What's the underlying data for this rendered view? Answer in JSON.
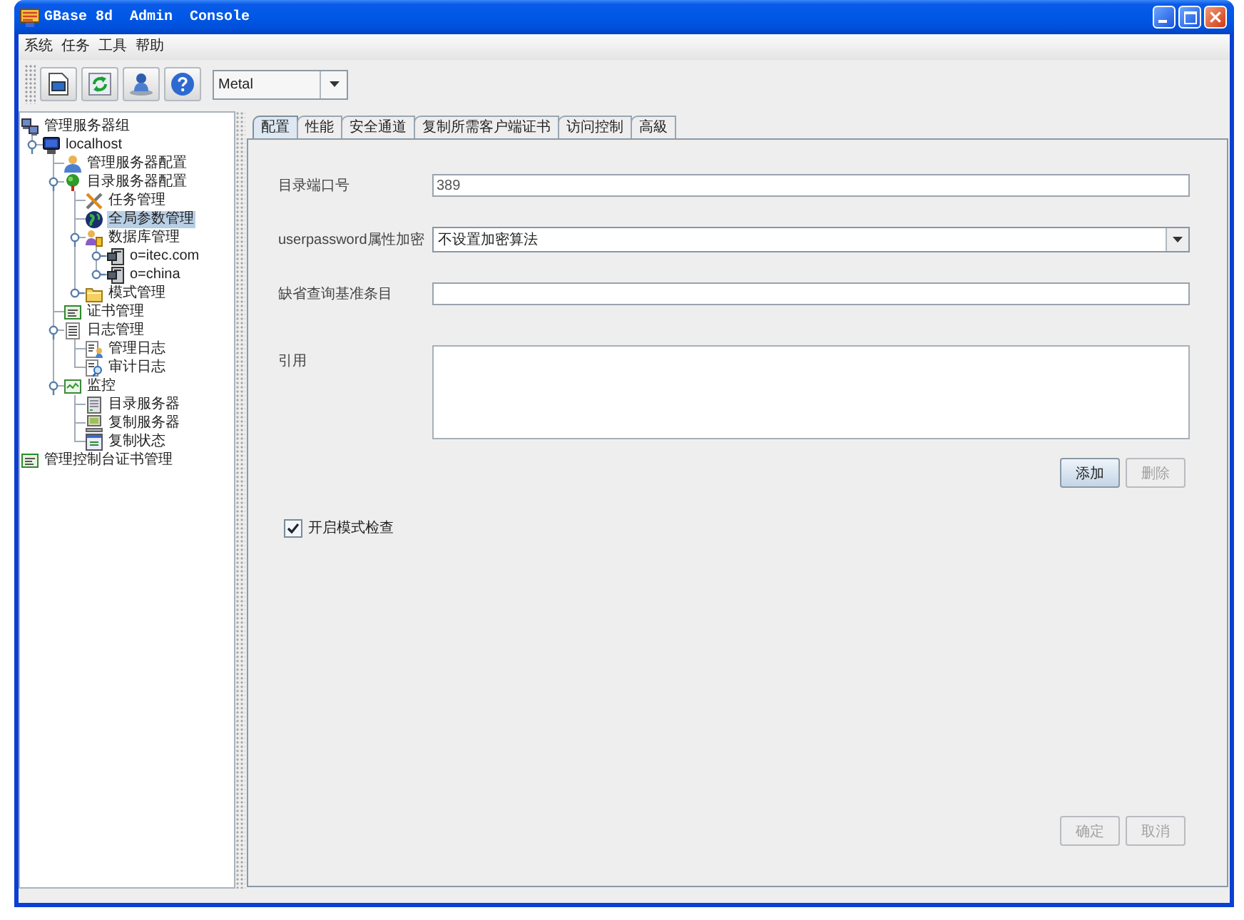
{
  "window": {
    "title": "GBase 8d  Admin  Console"
  },
  "menu_bar": [
    "系统",
    "任务",
    "工具",
    "帮助"
  ],
  "toolbar": {
    "look_and_feel": {
      "value": "Metal"
    }
  },
  "tree": [
    {
      "label": "管理服务器组",
      "kind": "group",
      "selected": false,
      "children": [
        {
          "label": "localhost",
          "kind": "host",
          "selected": false,
          "expanded": true,
          "children": [
            {
              "label": "管理服务器配置",
              "kind": "admin-config",
              "selected": false
            },
            {
              "label": "目录服务器配置",
              "kind": "directory-config",
              "selected": false,
              "expanded": true,
              "children": [
                {
                  "label": "任务管理",
                  "kind": "tasks",
                  "selected": false
                },
                {
                  "label": "全局参数管理",
                  "kind": "parameters",
                  "selected": true
                },
                {
                  "label": "数据库管理",
                  "kind": "databases",
                  "selected": false,
                  "expanded": true,
                  "children": [
                    {
                      "label": "o=itec.com",
                      "kind": "suffix",
                      "selected": false,
                      "expanded": false
                    },
                    {
                      "label": "o=china",
                      "kind": "suffix",
                      "selected": false,
                      "expanded": false
                    }
                  ]
                },
                {
                  "label": "模式管理",
                  "kind": "schema",
                  "selected": false,
                  "expanded": false
                }
              ]
            },
            {
              "label": "证书管理",
              "kind": "certificates",
              "selected": false
            },
            {
              "label": "日志管理",
              "kind": "logs",
              "selected": false,
              "expanded": true,
              "children": [
                {
                  "label": "管理日志",
                  "kind": "admin-log",
                  "selected": false
                },
                {
                  "label": "审计日志",
                  "kind": "audit-log",
                  "selected": false
                }
              ]
            },
            {
              "label": "监控",
              "kind": "monitor",
              "selected": false,
              "expanded": true,
              "children": [
                {
                  "label": "目录服务器",
                  "kind": "directory-server",
                  "selected": false
                },
                {
                  "label": "复制服务器",
                  "kind": "replication-server",
                  "selected": false
                },
                {
                  "label": "复制状态",
                  "kind": "replication-status",
                  "selected": false
                }
              ]
            }
          ]
        }
      ]
    },
    {
      "label": "管理控制台证书管理",
      "kind": "console-certificates",
      "selected": false
    }
  ],
  "tabs": [
    {
      "label": "配置",
      "selected": true
    },
    {
      "label": "性能",
      "selected": false
    },
    {
      "label": "安全通道",
      "selected": false
    },
    {
      "label": "复制所需客户端证书",
      "selected": false
    },
    {
      "label": "访问控制",
      "selected": false
    },
    {
      "label": "高級",
      "selected": false
    }
  ],
  "form": {
    "fields": [
      {
        "kind": "text",
        "label": "目录端口号",
        "value": "389"
      },
      {
        "kind": "select",
        "label": "userpassword属性加密",
        "value": "不设置加密算法"
      },
      {
        "kind": "text",
        "label": "缺省查询基准条目"
      },
      {
        "kind": "textarea",
        "label": "引用"
      }
    ],
    "list_buttons": [
      {
        "label": "添加",
        "disabled": false
      },
      {
        "label": "删除",
        "disabled": true
      }
    ],
    "option": {
      "label": "开启模式检查",
      "checked": true
    },
    "dialog_buttons": [
      {
        "label": "确定",
        "disabled": true
      },
      {
        "label": "取消",
        "disabled": true
      }
    ]
  }
}
